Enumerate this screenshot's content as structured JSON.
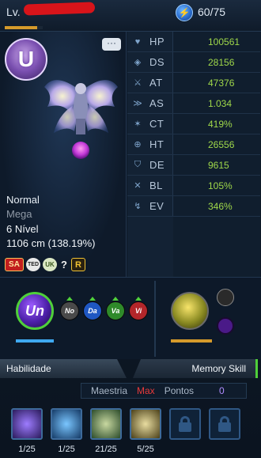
{
  "header": {
    "lv_label": "Lv.",
    "energy": "60/75",
    "level_exp_fraction": 0.85
  },
  "digimon": {
    "form": "Normal",
    "type": "Mega",
    "level": "6 Nível",
    "size": "1106 cm (138.19%)"
  },
  "badges": [
    "SA",
    "TED",
    "UK",
    "?",
    "R"
  ],
  "stats": [
    {
      "label": "HP",
      "value": "100561",
      "icon": "heart-icon"
    },
    {
      "label": "DS",
      "value": "28156",
      "icon": "ds-icon"
    },
    {
      "label": "AT",
      "value": "47376",
      "icon": "sword-icon"
    },
    {
      "label": "AS",
      "value": "1.034",
      "icon": "attack-speed-icon"
    },
    {
      "label": "CT",
      "value": "419%",
      "icon": "critical-icon"
    },
    {
      "label": "HT",
      "value": "26556",
      "icon": "crosshair-icon"
    },
    {
      "label": "DE",
      "value": "9615",
      "icon": "shield-icon"
    },
    {
      "label": "BL",
      "value": "105%",
      "icon": "block-icon"
    },
    {
      "label": "EV",
      "value": "346%",
      "icon": "evade-icon"
    }
  ],
  "evolution": {
    "label": "Un",
    "bar_fraction": 1.0
  },
  "attributes": [
    {
      "label": "No",
      "color": "#4a4a4a"
    },
    {
      "label": "Da",
      "color": "#1f57c2"
    },
    {
      "label": "Va",
      "color": "#2f8a2a"
    },
    {
      "label": "Vi",
      "color": "#b3262a"
    }
  ],
  "element": {
    "bar_fraction": 0.9
  },
  "tabs": {
    "left": "Habilidade",
    "right": "Memory Skill"
  },
  "mastery": {
    "label": "Maestria",
    "value": "Max",
    "points_label": "Pontos",
    "points_value": "0"
  },
  "skills": [
    {
      "level": "1/25",
      "color": "#5a3aa8"
    },
    {
      "level": "1/25",
      "color": "#2b78b8"
    },
    {
      "level": "21/25",
      "color": "#4a7a4a"
    },
    {
      "level": "5/25",
      "color": "#8a7a30"
    },
    {
      "locked": true
    },
    {
      "locked": true
    }
  ]
}
